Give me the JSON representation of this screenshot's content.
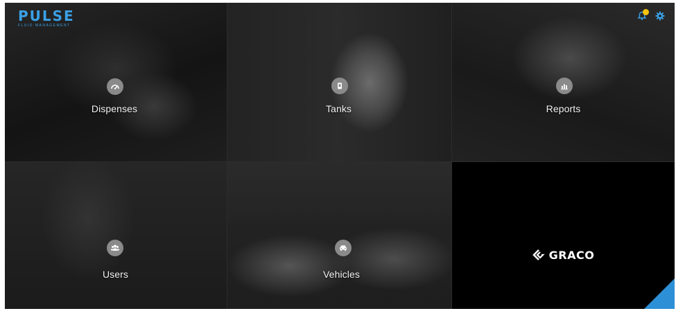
{
  "brand": {
    "name": "PULSE",
    "subtitle": "FLUID MANAGEMENT",
    "accent_color": "#3aa0e6",
    "notification_dot_color": "#f4c20d"
  },
  "header": {
    "icons": [
      "bell-icon",
      "gear-icon"
    ]
  },
  "tiles": [
    {
      "label": "Dispenses",
      "icon": "gauge-icon"
    },
    {
      "label": "Tanks",
      "icon": "tank-icon"
    },
    {
      "label": "Reports",
      "icon": "bar-chart-icon"
    },
    {
      "label": "Users",
      "icon": "users-icon"
    },
    {
      "label": "Vehicles",
      "icon": "car-icon"
    }
  ],
  "partner": {
    "name": "GRACO",
    "corner_color": "#2d8fd6"
  }
}
